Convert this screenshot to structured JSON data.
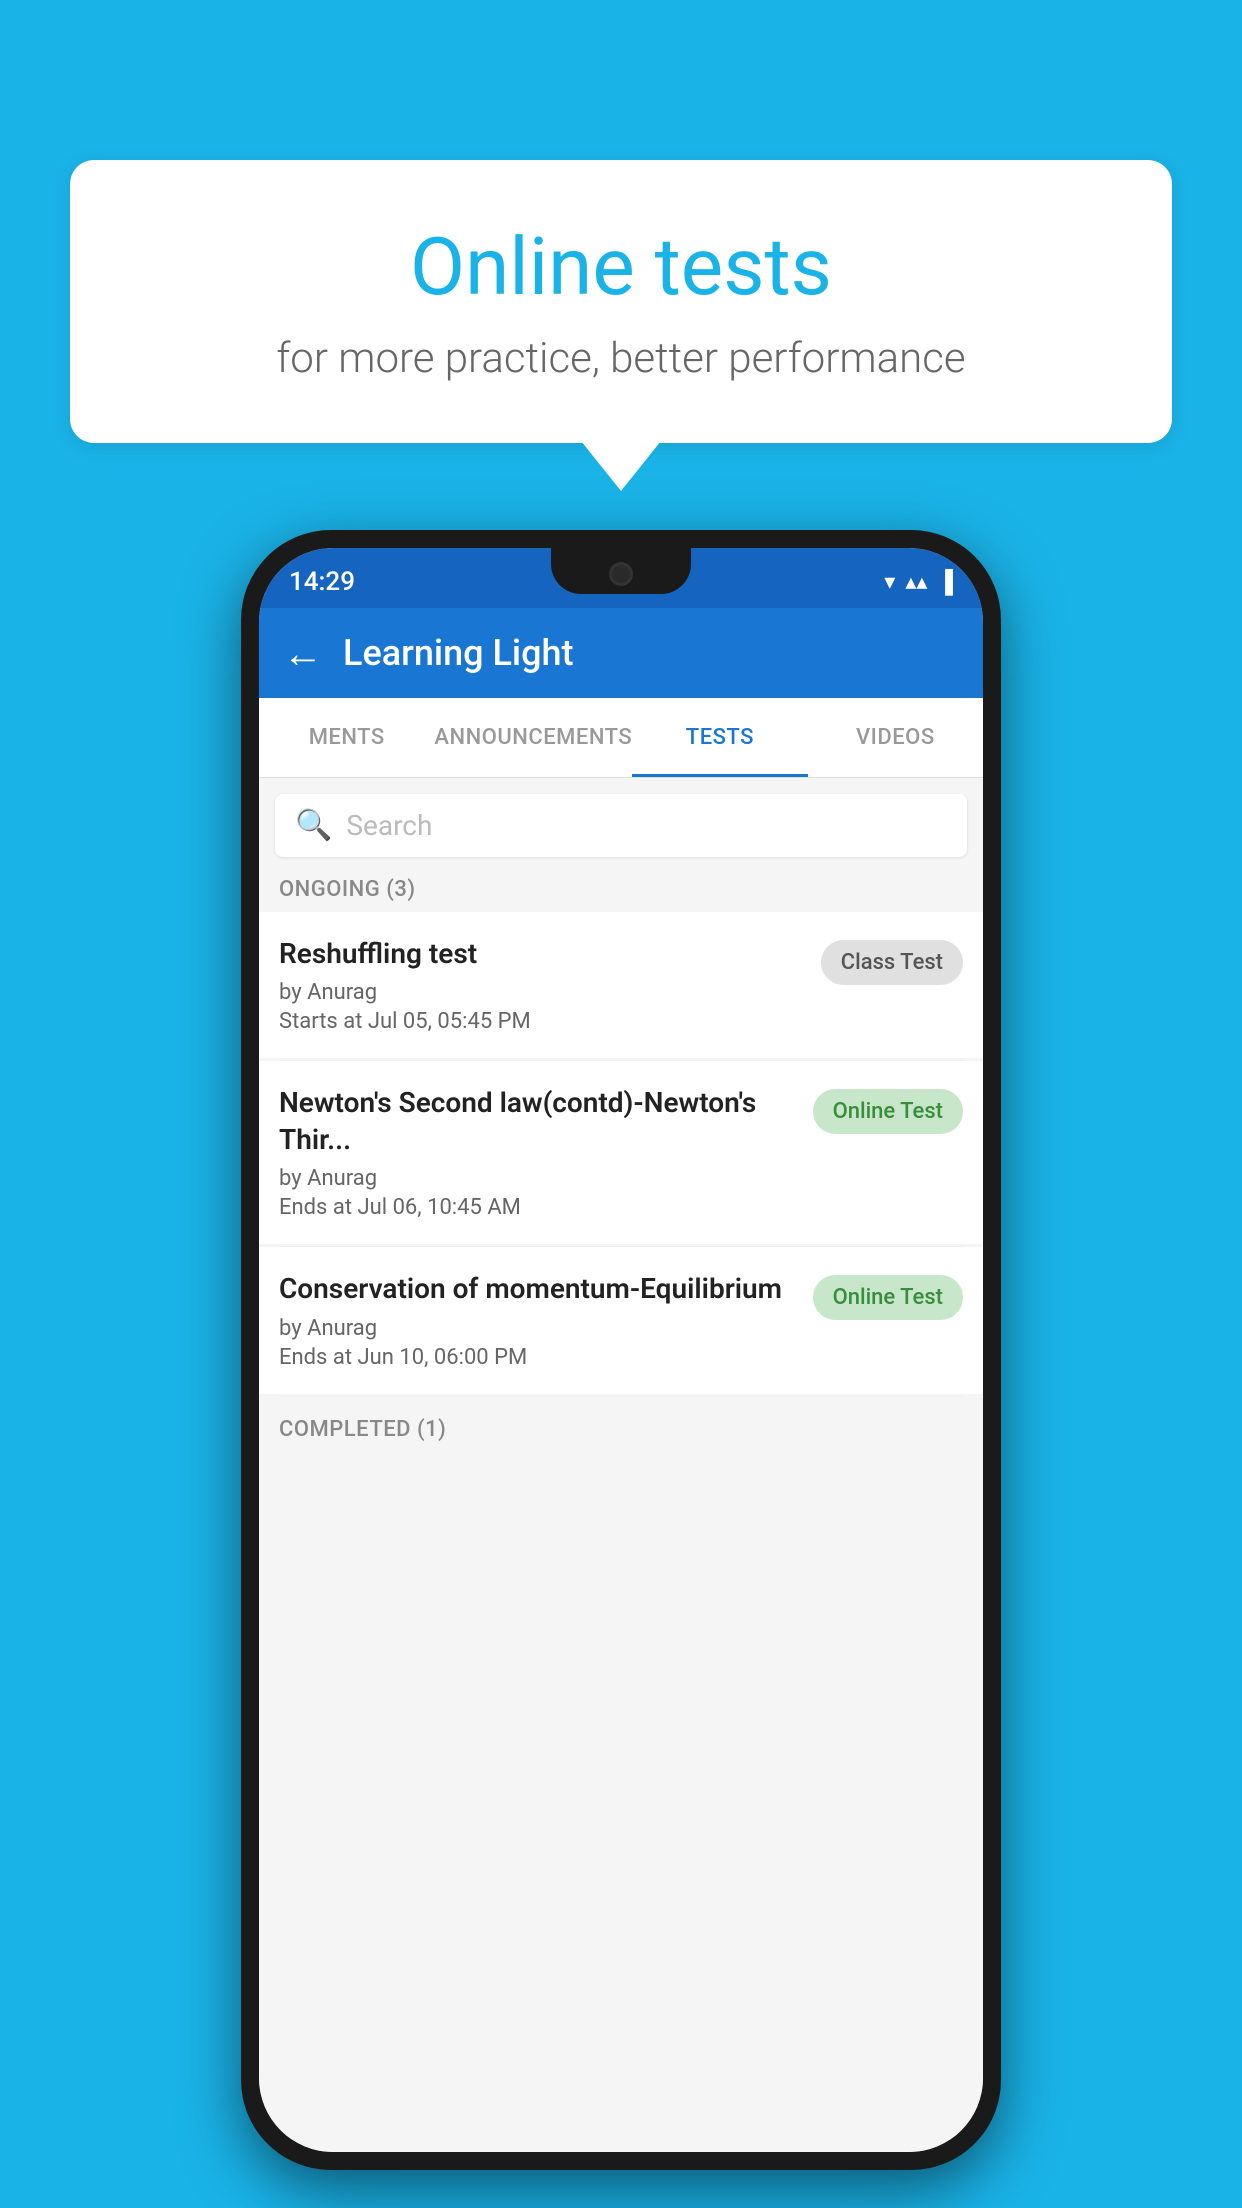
{
  "background": {
    "color": "#1ab3e8"
  },
  "speech_bubble": {
    "title": "Online tests",
    "subtitle": "for more practice, better performance"
  },
  "phone": {
    "status_bar": {
      "time": "14:29",
      "wifi": "▼",
      "signal": "▲",
      "battery": "▐"
    },
    "header": {
      "back_label": "←",
      "title": "Learning Light"
    },
    "tabs": [
      {
        "label": "MENTS",
        "active": false
      },
      {
        "label": "ANNOUNCEMENTS",
        "active": false
      },
      {
        "label": "TESTS",
        "active": true
      },
      {
        "label": "VIDEOS",
        "active": false
      }
    ],
    "search": {
      "placeholder": "Search"
    },
    "ongoing_section": {
      "header": "ONGOING (3)"
    },
    "tests": [
      {
        "name": "Reshuffling test",
        "author": "by Anurag",
        "date": "Starts at  Jul 05, 05:45 PM",
        "badge": "Class Test",
        "badge_type": "class"
      },
      {
        "name": "Newton's Second law(contd)-Newton's Thir...",
        "author": "by Anurag",
        "date": "Ends at  Jul 06, 10:45 AM",
        "badge": "Online Test",
        "badge_type": "online"
      },
      {
        "name": "Conservation of momentum-Equilibrium",
        "author": "by Anurag",
        "date": "Ends at  Jun 10, 06:00 PM",
        "badge": "Online Test",
        "badge_type": "online"
      }
    ],
    "completed_section": {
      "header": "COMPLETED (1)"
    }
  }
}
